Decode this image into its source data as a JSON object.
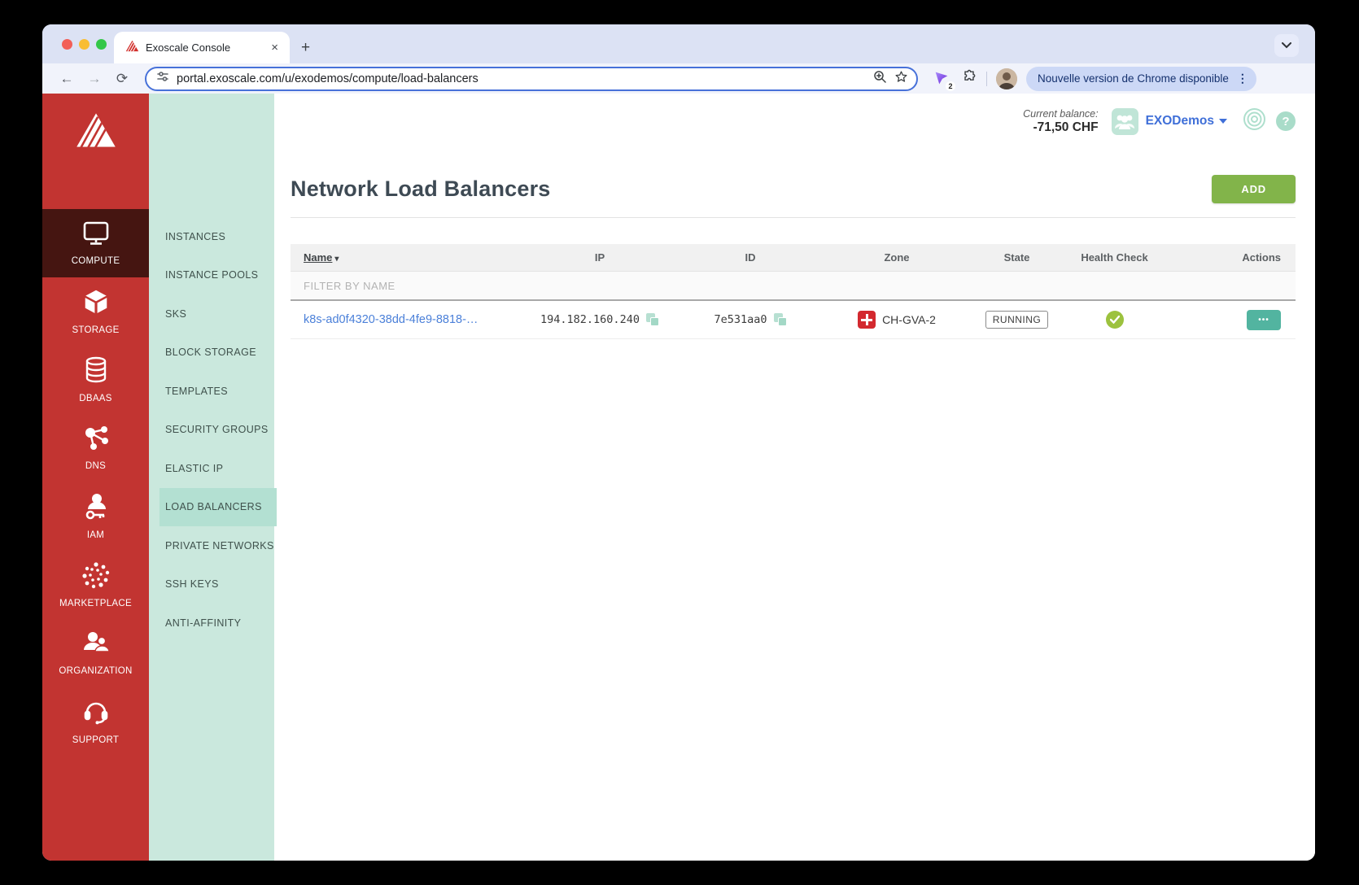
{
  "browser": {
    "tab_title": "Exoscale Console",
    "tab_close": "×",
    "new_tab": "+",
    "url": "portal.exoscale.com/u/exodemos/compute/load-balancers",
    "extension_badge": "2",
    "update_pill": "Nouvelle version de Chrome disponible",
    "menu_dots": "⋮",
    "back": "←",
    "forward": "→",
    "reload": "⟳",
    "tab_chevron": "⌄"
  },
  "primary_nav": {
    "items": [
      {
        "label": "COMPUTE"
      },
      {
        "label": "STORAGE"
      },
      {
        "label": "DBAAS"
      },
      {
        "label": "DNS"
      },
      {
        "label": "IAM"
      },
      {
        "label": "MARKETPLACE"
      },
      {
        "label": "ORGANIZATION"
      },
      {
        "label": "SUPPORT"
      }
    ]
  },
  "submenu": {
    "items": [
      "INSTANCES",
      "INSTANCE POOLS",
      "SKS",
      "BLOCK STORAGE",
      "TEMPLATES",
      "SECURITY GROUPS",
      "ELASTIC IP",
      "LOAD BALANCERS",
      "PRIVATE NETWORKS",
      "SSH KEYS",
      "ANTI-AFFINITY"
    ],
    "active": "LOAD BALANCERS"
  },
  "account": {
    "balance_label": "Current balance:",
    "balance_value": "-71,50 CHF",
    "org_name": "EXODemos",
    "help": "?"
  },
  "page": {
    "title": "Network Load Balancers",
    "add_button": "ADD"
  },
  "table": {
    "columns": [
      "Name",
      "IP",
      "ID",
      "Zone",
      "State",
      "Health Check",
      "Actions"
    ],
    "sort_arrow": "▾",
    "filter_placeholder": "FILTER BY NAME",
    "rows": [
      {
        "name": "k8s-ad0f4320-38dd-4fe9-8818-…",
        "ip": "194.182.160.240",
        "id": "7e531aa0",
        "zone": "CH-GVA-2",
        "state": "RUNNING",
        "health": "passing",
        "actions_label": "•••"
      }
    ]
  },
  "colors": {
    "accent_red": "#c23431",
    "accent_mint": "#cae8dd",
    "add_green": "#82b44a",
    "action_teal": "#52b4a0",
    "link_blue": "#4b80d9"
  }
}
